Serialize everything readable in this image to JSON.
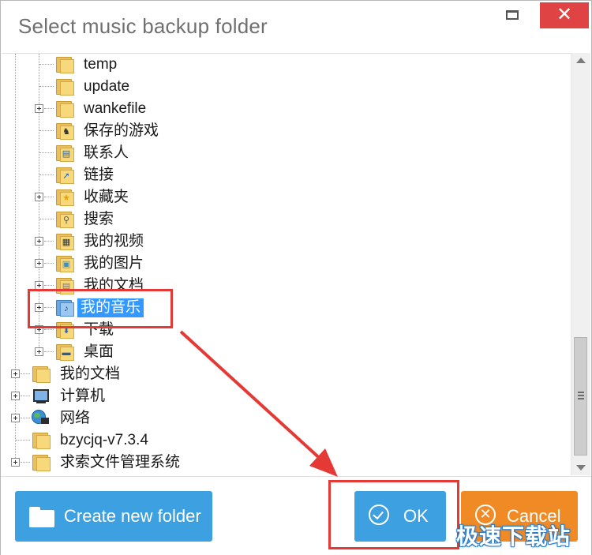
{
  "window": {
    "title": "Select music backup folder",
    "close_glyph": "✕"
  },
  "tree": {
    "items": [
      {
        "label": "temp",
        "icon": "folder-icon",
        "expandable": false
      },
      {
        "label": "update",
        "icon": "folder-icon",
        "expandable": false
      },
      {
        "label": "wankefile",
        "icon": "folder-icon",
        "expandable": true
      },
      {
        "label": "保存的游戏",
        "icon": "saved-games-folder-icon",
        "expandable": false
      },
      {
        "label": "联系人",
        "icon": "contacts-folder-icon",
        "expandable": false
      },
      {
        "label": "链接",
        "icon": "links-folder-icon",
        "expandable": false
      },
      {
        "label": "收藏夹",
        "icon": "favorites-folder-icon",
        "expandable": true
      },
      {
        "label": "搜索",
        "icon": "searches-folder-icon",
        "expandable": false
      },
      {
        "label": "我的视频",
        "icon": "videos-folder-icon",
        "expandable": true
      },
      {
        "label": "我的图片",
        "icon": "pictures-folder-icon",
        "expandable": true
      },
      {
        "label": "我的文档",
        "icon": "documents-folder-icon",
        "expandable": true
      },
      {
        "label": "我的音乐",
        "icon": "music-folder-icon",
        "expandable": true,
        "selected": true
      },
      {
        "label": "下载",
        "icon": "downloads-folder-icon",
        "expandable": true
      },
      {
        "label": "桌面",
        "icon": "desktop-folder-icon",
        "expandable": true
      },
      {
        "label": "我的文档",
        "icon": "documents-folder-icon",
        "expandable": true
      },
      {
        "label": "计算机",
        "icon": "computer-icon",
        "expandable": true
      },
      {
        "label": "网络",
        "icon": "network-icon",
        "expandable": true
      },
      {
        "label": "bzycjq-v7.3.4",
        "icon": "folder-icon",
        "expandable": false
      },
      {
        "label": "求索文件管理系统",
        "icon": "folder-icon",
        "expandable": true
      }
    ]
  },
  "buttons": {
    "create_folder": "Create new folder",
    "ok": "OK",
    "cancel": "Cancel",
    "cancel_glyph": "✕"
  },
  "watermark": "极速下载站",
  "colors": {
    "button_blue": "#3da0e0",
    "button_orange": "#f08a24",
    "selection": "#3399ff",
    "annotation_red": "#e53935"
  }
}
